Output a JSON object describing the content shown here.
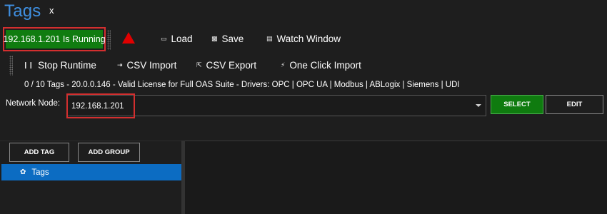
{
  "window": {
    "title": "Tags",
    "close_label": "x"
  },
  "status": {
    "text": "192.168.1.201 Is Running",
    "color": "#107c10"
  },
  "toolbar": {
    "load": {
      "label": "Load",
      "icon": "folder-icon"
    },
    "save": {
      "label": "Save",
      "icon": "save-icon"
    },
    "watch": {
      "label": "Watch Window",
      "icon": "watch-window-icon"
    },
    "stop": {
      "label": "Stop Runtime",
      "icon": "pause-icon"
    },
    "csv_import": {
      "label": "CSV Import",
      "icon": "import-icon"
    },
    "csv_export": {
      "label": "CSV Export",
      "icon": "export-icon"
    },
    "one_click": {
      "label": "One Click Import",
      "icon": "lightning-icon"
    }
  },
  "license_text": "0 / 10 Tags - 20.0.0.146 - Valid License for Full OAS Suite - Drivers: OPC | OPC UA | Modbus | ABLogix | Siemens | UDI",
  "network_node": {
    "label": "Network Node:",
    "value": "192.168.1.201"
  },
  "buttons": {
    "select": "SELECT",
    "edit": "EDIT",
    "add_tag": "ADD TAG",
    "add_group": "ADD GROUP"
  },
  "tree": {
    "items": [
      {
        "label": "Tags",
        "icon": "gear-icon",
        "selected": true
      }
    ]
  },
  "colors": {
    "accent": "#3f8fe0",
    "highlight": "#d32f2f",
    "selection": "#0c6cc2",
    "warning": "#e00000"
  }
}
